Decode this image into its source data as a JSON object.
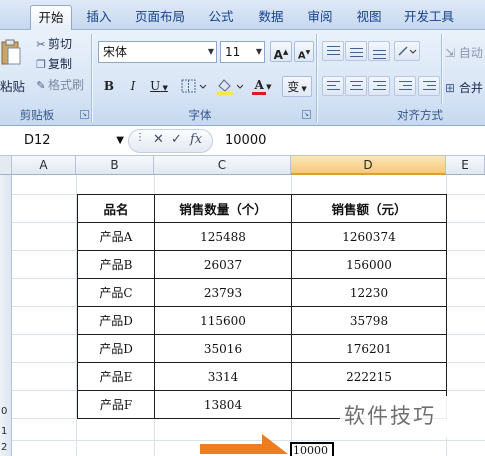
{
  "ribbon": {
    "tabs": [
      "开始",
      "插入",
      "页面布局",
      "公式",
      "数据",
      "审阅",
      "视图",
      "开发工具"
    ],
    "active_tab": "开始",
    "clipboard": {
      "paste_label": "粘贴",
      "cut_label": "剪切",
      "copy_label": "复制",
      "format_painter_label": "格式刷",
      "group_label": "剪贴板"
    },
    "font": {
      "font_name": "宋体",
      "font_size": "11",
      "grow_label": "A",
      "shrink_label": "A",
      "bold_label": "B",
      "italic_label": "I",
      "underline_label": "U",
      "font_color_label": "A",
      "phonetic_label": "变",
      "group_label": "字体"
    },
    "alignment": {
      "wrap_label": "自动",
      "merge_label": "合并",
      "group_label": "对齐方式"
    },
    "colors": {
      "accent": "#15428b",
      "font_color_bar": "#e0191c",
      "fill_bar": "#f7e64a"
    }
  },
  "formula_bar": {
    "name_box": "D12",
    "cancel_icon": "✕",
    "enter_icon": "✓",
    "fx_label": "fx",
    "value": "10000"
  },
  "columns": [
    "A",
    "B",
    "C",
    "D",
    "E"
  ],
  "selected_column": "D",
  "row_numbers": [
    "0",
    "1",
    "2"
  ],
  "table": {
    "headers": [
      "品名",
      "销售数量（个）",
      "销售额（元）"
    ],
    "rows": [
      [
        "产品A",
        "125488",
        "1260374"
      ],
      [
        "产品B",
        "26037",
        "156000"
      ],
      [
        "产品C",
        "23793",
        "12230"
      ],
      [
        "产品D",
        "115600",
        "35798"
      ],
      [
        "产品D",
        "35016",
        "176201"
      ],
      [
        "产品E",
        "3314",
        "222215"
      ],
      [
        "产品F",
        "13804",
        ""
      ]
    ]
  },
  "active_cell_value": "10000",
  "watermark": "软件技巧"
}
